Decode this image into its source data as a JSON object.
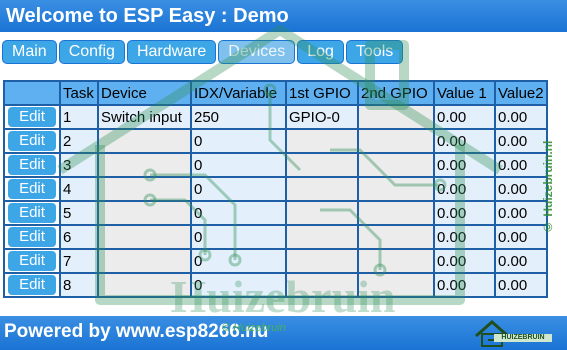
{
  "header": {
    "title": "Welcome to ESP Easy : Demo"
  },
  "nav": {
    "tabs": [
      {
        "label": "Main"
      },
      {
        "label": "Config"
      },
      {
        "label": "Hardware"
      },
      {
        "label": "Devices",
        "active": true
      },
      {
        "label": "Log"
      },
      {
        "label": "Tools"
      }
    ]
  },
  "table": {
    "headers": [
      "",
      "Task",
      "Device",
      "IDX/Variable",
      "1st GPIO",
      "2nd GPIO",
      "Value 1",
      "Value2"
    ],
    "rows": [
      {
        "edit": "Edit",
        "task": "1",
        "device": "Switch input",
        "idx": "250",
        "gpio1": "GPIO-0",
        "gpio2": "",
        "value1": "0.00",
        "value2": "0.00"
      },
      {
        "edit": "Edit",
        "task": "2",
        "device": "",
        "idx": "0",
        "gpio1": "",
        "gpio2": "",
        "value1": "0.00",
        "value2": "0.00"
      },
      {
        "edit": "Edit",
        "task": "3",
        "device": "",
        "idx": "0",
        "gpio1": "",
        "gpio2": "",
        "value1": "0.00",
        "value2": "0.00"
      },
      {
        "edit": "Edit",
        "task": "4",
        "device": "",
        "idx": "0",
        "gpio1": "",
        "gpio2": "",
        "value1": "0.00",
        "value2": "0.00"
      },
      {
        "edit": "Edit",
        "task": "5",
        "device": "",
        "idx": "0",
        "gpio1": "",
        "gpio2": "",
        "value1": "0.00",
        "value2": "0.00"
      },
      {
        "edit": "Edit",
        "task": "6",
        "device": "",
        "idx": "0",
        "gpio1": "",
        "gpio2": "",
        "value1": "0.00",
        "value2": "0.00"
      },
      {
        "edit": "Edit",
        "task": "7",
        "device": "",
        "idx": "0",
        "gpio1": "",
        "gpio2": "",
        "value1": "0.00",
        "value2": "0.00"
      },
      {
        "edit": "Edit",
        "task": "8",
        "device": "",
        "idx": "0",
        "gpio1": "",
        "gpio2": "",
        "value1": "0.00",
        "value2": "0.00"
      }
    ]
  },
  "watermark": {
    "main_text": "Huizebruin",
    "side_text": "© Huizebruin.nl",
    "logo_icon": "house-circuit-icon",
    "logo_text": "HUIZEBRUIN"
  },
  "footer": {
    "text": "Powered by www.esp8266.nu",
    "sub_text": "© Huizebruin"
  },
  "colors": {
    "header_blue": "#1b74d4",
    "button_blue": "#3da6e6",
    "table_border": "#1e5fa6",
    "watermark_green": "#2e8b2e"
  }
}
